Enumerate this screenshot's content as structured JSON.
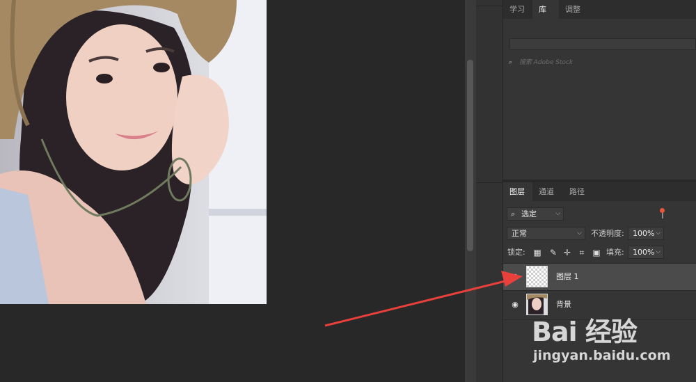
{
  "library_panel": {
    "tabs": [
      "学习",
      "库",
      "调整"
    ],
    "active_tab": "库",
    "search_placeholder": "搜索 Adobe Stock"
  },
  "layers_panel": {
    "tabs": [
      "图层",
      "通道",
      "路径"
    ],
    "active_tab": "图层",
    "filter_kind": "选定",
    "blend_mode": "正常",
    "opacity_label": "不透明度:",
    "opacity_value": "100%",
    "lock_label": "锁定:",
    "fill_label": "填充:",
    "fill_value": "100%",
    "layers": [
      {
        "name": "图层 1",
        "visible": true,
        "selected": true,
        "thumb": "transparent-checker"
      },
      {
        "name": "背景",
        "visible": true,
        "selected": false,
        "thumb": "photo-thumbnail"
      }
    ]
  },
  "watermark": {
    "brand": "Bai 经验",
    "url": "jingyan.baidu.com"
  },
  "colors": {
    "arrow": "#e8403a",
    "filter_dot": "#e8573a"
  }
}
